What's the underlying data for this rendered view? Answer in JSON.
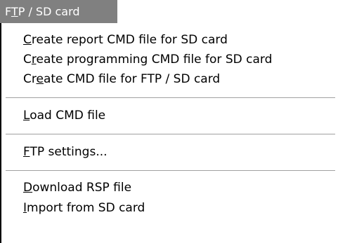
{
  "menubar": {
    "title_prefix": "F",
    "title_mnemonic": "T",
    "title_suffix": "P / SD card"
  },
  "menu": {
    "items": [
      {
        "pre": "",
        "mn": "C",
        "post": "reate report CMD file for SD card"
      },
      {
        "pre": "C",
        "mn": "r",
        "post": "eate programming CMD file for SD card"
      },
      {
        "pre": "Cr",
        "mn": "e",
        "post": "ate CMD file for FTP / SD card"
      },
      {
        "pre": "",
        "mn": "L",
        "post": "oad CMD file"
      },
      {
        "pre": "",
        "mn": "F",
        "post": "TP settings..."
      },
      {
        "pre": "",
        "mn": "D",
        "post": "ownload RSP file"
      },
      {
        "pre": "",
        "mn": "I",
        "post": "mport from SD card"
      }
    ]
  },
  "colors": {
    "menubar_active_bg": "#808080",
    "menubar_active_text": "#ffffff",
    "menu_bg": "#ffffff",
    "separator": "#a0a0a0"
  }
}
